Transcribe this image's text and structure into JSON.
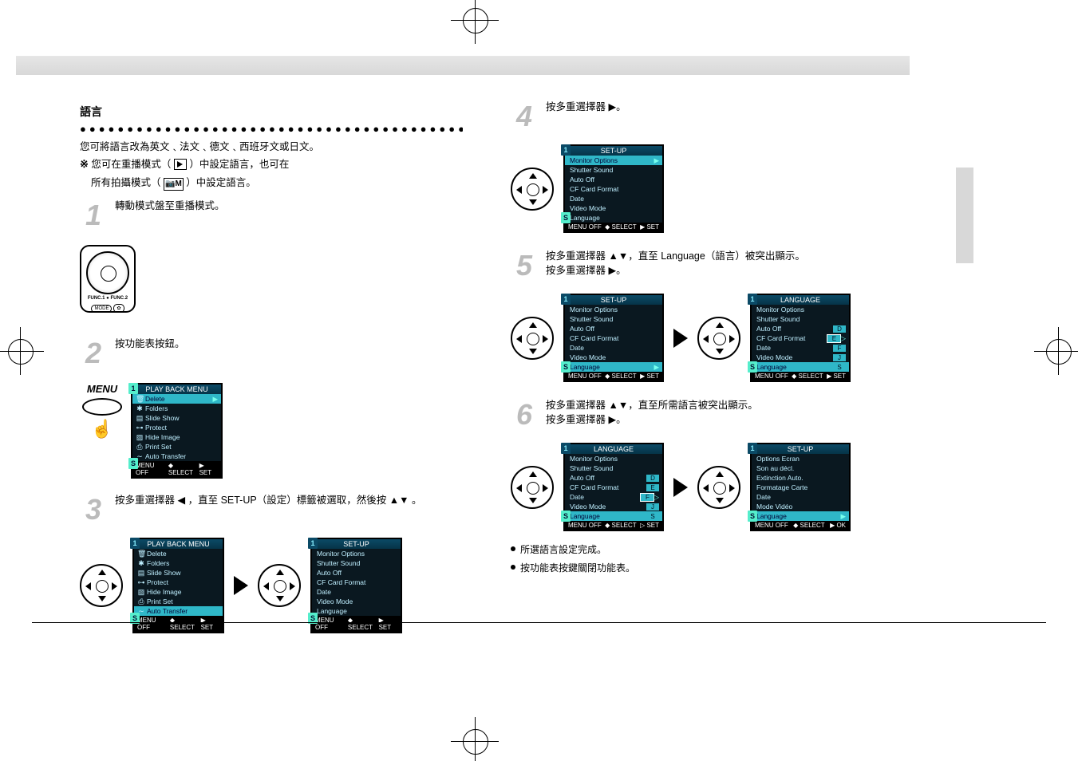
{
  "left": {
    "heading": "語言",
    "intro": "您可將語言改為英文﹑法文﹑德文﹑西班牙文或日文。",
    "note1_pre": "您可在重播模式（",
    "note1_post": "）中設定語言，也可在",
    "note2_pre": "所有拍攝模式（",
    "note2_post": "）中設定語言。",
    "step1": {
      "num": "1",
      "text": "轉動模式盤至重播模式。"
    },
    "step2": {
      "num": "2",
      "text": "按功能表按鈕。"
    },
    "menu_label": "MENU",
    "lcd_playback": {
      "title": "PLAY BACK MENU",
      "items": [
        "Delete",
        "Folders",
        "Slide Show",
        "Protect",
        "Hide Image",
        "Print Set",
        "Auto Transfer"
      ],
      "foot": {
        "off": "MENU OFF",
        "select": "SELECT",
        "set": "SET"
      }
    },
    "step3": {
      "num": "3",
      "pre": "按多重選擇器 ",
      "arrows": "◀",
      "post": "，直至 SET-UP（設定）標籤被選取，然後按",
      "arrows2": "▲▼",
      "post2": "。"
    },
    "lcd_setup": {
      "title": "SET-UP",
      "items": [
        "Monitor Options",
        "Shutter Sound",
        "Auto Off",
        "CF Card Format",
        "Date",
        "Video Mode",
        "Language"
      ],
      "foot": {
        "off": "MENU OFF",
        "select": "SELECT",
        "set": "SET"
      }
    }
  },
  "right": {
    "step4": {
      "num": "4",
      "text_pre": "按多重選擇器 ",
      "arrow": "▶",
      "text_post": "。"
    },
    "step5": {
      "num": "5",
      "line1_pre": "按多重選擇器 ",
      "line1_arrows": "▲▼",
      "line1_mid": "，直至 Language（語言）被突出顯示。",
      "line2_pre": "按多重選擇器 ",
      "line2_arrow": "▶",
      "line2_post": "。"
    },
    "lcd_language": {
      "title": "LANGUAGE",
      "items": [
        "Monitor Options",
        "Shutter Sound",
        "Auto Off",
        "CF Card Format",
        "Date",
        "Video Mode",
        "Language"
      ],
      "caps": [
        "",
        "",
        "D",
        "E",
        "F",
        "J",
        "S"
      ]
    },
    "step6": {
      "num": "6",
      "line1_pre": "按多重選擇器 ",
      "line1_arrows": "▲▼",
      "line1_post": "，直至所需語言被突出顯示。",
      "line2_pre": "按多重選擇器 ",
      "line2_arrow": "▶",
      "line2_post": "。"
    },
    "lcd_setup_fr": {
      "title": "SET-UP",
      "items": [
        "Options Ecran",
        "Son au décl.",
        "Extinction Auto.",
        "Formatage Carte",
        "Date",
        "Mode Vidéo",
        "Language"
      ],
      "foot_ok": "OK"
    },
    "bullet1": "所選語言設定完成。",
    "bullet2": "按功能表按鍵關閉功能表。"
  },
  "common": {
    "foot_off": "MENU OFF",
    "foot_sel": "SELECT",
    "foot_set": "SET"
  }
}
